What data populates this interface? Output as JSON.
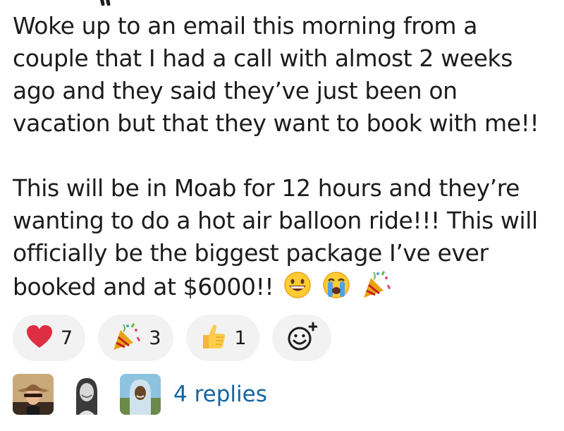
{
  "message": {
    "paragraphs": [
      "Woke up to an email this morning from a\ncouple that I had a call with almost 2 weeks\nago and they said they’ve just been on\nvacation but that they want to book with me!!",
      "This will be in Moab for 12 hours and they’re\nwanting to do a hot air balloon ride!!! This will\nofficially be the biggest package I’ve ever\nbooked and at $6000!!"
    ],
    "trailing_emojis": [
      "grinning-face",
      "loudly-crying-face",
      "party-popper"
    ]
  },
  "reactions": [
    {
      "emoji": "red-heart",
      "count": "7"
    },
    {
      "emoji": "party-popper",
      "count": "3"
    },
    {
      "emoji": "thumbs-up",
      "count": "1"
    }
  ],
  "add_reaction": {
    "icon": "add-reaction-icon"
  },
  "thread": {
    "avatars": [
      "avatar-1",
      "avatar-2",
      "avatar-3"
    ],
    "replies_label": "4 replies"
  },
  "colors": {
    "link": "#1264a3",
    "pill_bg": "#f2f2f2",
    "text": "#1d1c1d"
  }
}
